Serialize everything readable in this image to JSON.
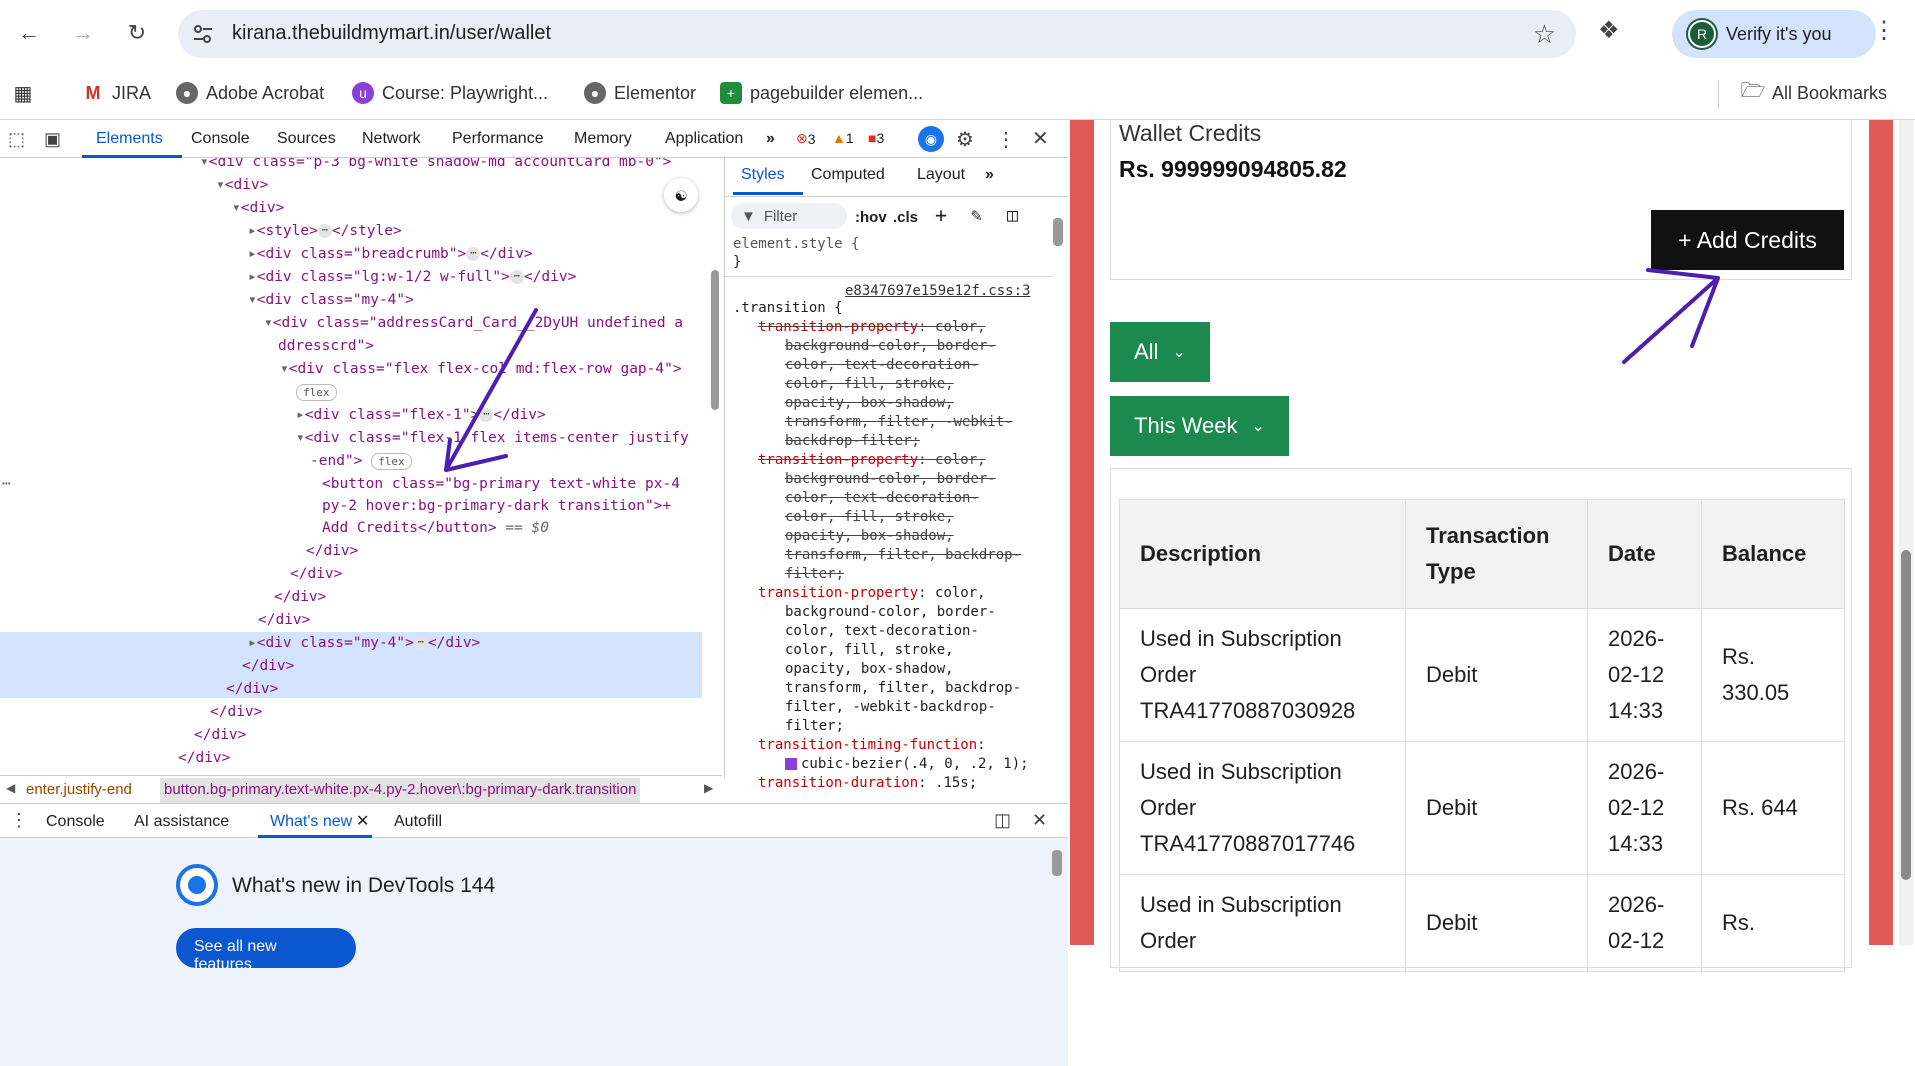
{
  "browser": {
    "url": "kirana.thebuildmymart.in/user/wallet",
    "verify_label": "Verify it's you",
    "avatar_letter": "R",
    "bookmarks": [
      "JIRA",
      "Adobe Acrobat",
      "Course: Playwright...",
      "Elementor",
      "pagebuilder elemen..."
    ],
    "all_bookmarks": "All Bookmarks"
  },
  "devtools": {
    "tabs": [
      "Elements",
      "Console",
      "Sources",
      "Network",
      "Performance",
      "Memory",
      "Application"
    ],
    "errors": "3",
    "warnings": "1",
    "issues": "3",
    "dom": {
      "l0": "<div class=\"p-3 bg-white shadow-md  accountCard mb-0\">",
      "l1": "<div>",
      "l2": "<div>",
      "l3a": "<style>",
      "l3b": "</style>",
      "l4a": "<div class=\"breadcrumb\">",
      "l4b": "</div>",
      "l5a": "<div class=\"lg:w-1/2 w-full\">",
      "l5b": "</div>",
      "l6": "<div class=\"my-4\">",
      "l7a": "<div class=\"addressCard_Card__2DyUH undefined a",
      "l7b": "ddresscrd\">",
      "l8": "<div class=\"flex flex-col md:flex-row gap-4\">",
      "flex": "flex",
      "l9a": "<div class=\"flex-1\">",
      "l9b": "</div>",
      "l10a": "<div class=\"flex-1 flex items-center justify",
      "l10b": "-end\">",
      "sel1": "<button class=\"bg-primary text-white px-4",
      "sel2": "py-2 hover:bg-primary-dark transition\">+",
      "sel3": "Add Credits</button>",
      "sel_eq": "== $0",
      "c1": "</div>",
      "c2": "</div>",
      "c3": "</div>",
      "c4": "</div>",
      "l15a": "<div class=\"my-4\">",
      "l15b": "</div>",
      "c5": "</div>",
      "c6": "</div>",
      "c7": "</div>",
      "c8": "</div>",
      "c9": "</div>"
    },
    "crumb1": "enter.justify-end",
    "crumb2": "button.bg-primary.text-white.px-4.py-2.hover\\:bg-primary-dark.transition",
    "styles_tabs": [
      "Styles",
      "Computed",
      "Layout"
    ],
    "filter_placeholder": "Filter",
    "hov": ":hov",
    "cls": ".cls",
    "element_style": "element.style {",
    "close_brace": "}",
    "source_link": "e8347697e159e12f.css:3",
    "selector": ".transition {",
    "css": {
      "p1": "transition-property",
      "v1": [
        "color,",
        "background-color, border-",
        "color, text-decoration-",
        "color, fill, stroke,",
        "opacity, box-shadow,",
        "transform, filter, -webkit-",
        "backdrop-filter;"
      ],
      "p2": "transition-property",
      "v2": [
        "color,",
        "background-color, border-",
        "color, text-decoration-",
        "color, fill, stroke,",
        "opacity, box-shadow,",
        "transform, filter, backdrop-",
        "filter;"
      ],
      "p3": "transition-property",
      "v3": [
        "color,",
        "background-color, border-",
        "color, text-decoration-",
        "color, fill, stroke,",
        "opacity, box-shadow,",
        "transform, filter, backdrop-",
        "filter, -webkit-backdrop-",
        "filter;"
      ],
      "p4": "transition-timing-function",
      "v4": "cubic-bezier(.4, 0, .2, 1);",
      "p5": "transition-duration",
      "v5": ".15s;"
    },
    "drawer_tabs": [
      "Console",
      "AI assistance",
      "What's new",
      "Autofill"
    ],
    "whats_new_title": "What's new in DevTools 144",
    "see_all": "See all new features"
  },
  "page": {
    "wallet_label": "Wallet Credits",
    "wallet_amount": "Rs. 999999094805.82",
    "add_credits": "+ Add Credits",
    "filter_all": "All",
    "filter_week": "This Week",
    "table": {
      "headers": [
        "Description",
        "Transaction Type",
        "Date",
        "Balance"
      ],
      "rows": [
        {
          "desc": "Used in Subscription Order TRA41770887030928",
          "type": "Debit",
          "date": "2026-02-12 14:33",
          "balance": "Rs. 330.05"
        },
        {
          "desc": "Used in Subscription Order TRA41770887017746",
          "type": "Debit",
          "date": "2026-02-12 14:33",
          "balance": "Rs. 644"
        },
        {
          "desc": "Used in Subscription Order",
          "type": "Debit",
          "date": "2026-02-12",
          "balance": "Rs."
        }
      ]
    }
  },
  "colors": {
    "accent": "#0b57d0",
    "green": "#1c8a4f",
    "red_bar": "#e05a5a",
    "annotation": "#4b1fb0"
  }
}
